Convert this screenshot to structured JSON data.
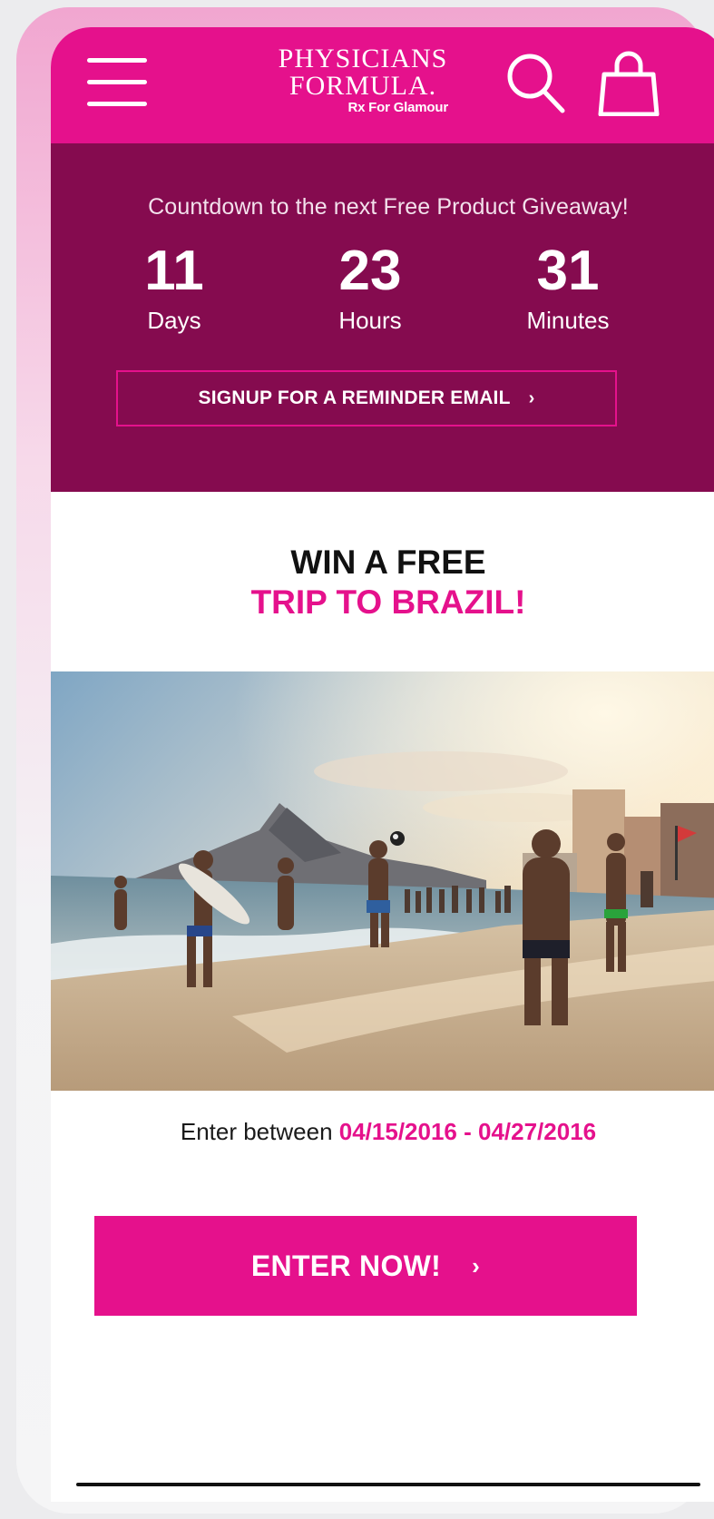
{
  "header": {
    "logo_line1": "PHYSICIANS",
    "logo_line2": "FORMULA.",
    "logo_tagline": "Rx For Glamour",
    "menu_icon": "hamburger-menu-icon",
    "search_icon": "search-icon",
    "cart_icon": "shopping-bag-icon"
  },
  "countdown": {
    "title": "Countdown to the next Free Product Giveaway!",
    "days": {
      "value": "11",
      "label": "Days"
    },
    "hours": {
      "value": "23",
      "label": "Hours"
    },
    "minutes": {
      "value": "31",
      "label": "Minutes"
    },
    "reminder_button": "SIGNUP FOR A REMINDER EMAIL",
    "reminder_chevron": "›"
  },
  "promo": {
    "title_line1": "WIN A FREE",
    "title_line2": "TRIP TO BRAZIL!",
    "enter_prefix": "Enter between",
    "enter_dates": "04/15/2016 - 04/27/2016",
    "enter_button": "ENTER NOW!",
    "enter_chevron": "›"
  },
  "colors": {
    "brand_pink": "#e5118c",
    "countdown_bg": "#850b4f",
    "text_dark": "#111111",
    "white": "#ffffff"
  }
}
